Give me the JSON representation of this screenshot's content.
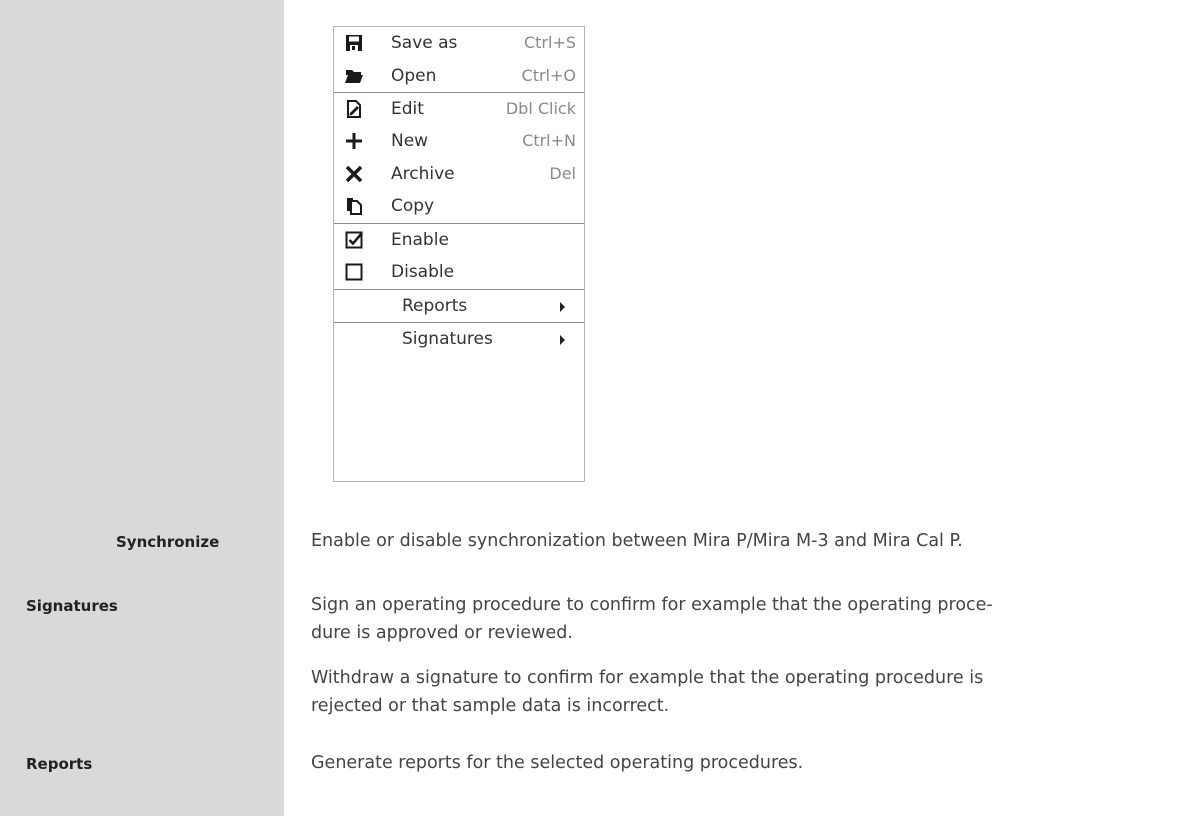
{
  "menu": {
    "items": [
      {
        "label": "Save as",
        "shortcut": "Ctrl+S",
        "icon": "save-icon"
      },
      {
        "label": "Open",
        "shortcut": "Ctrl+O",
        "icon": "folder-open-icon"
      },
      {
        "label": "Edit",
        "shortcut": "Dbl Click",
        "icon": "edit-icon"
      },
      {
        "label": "New",
        "shortcut": "Ctrl+N",
        "icon": "plus-icon"
      },
      {
        "label": "Archive",
        "shortcut": "Del",
        "icon": "x-icon"
      },
      {
        "label": "Copy",
        "shortcut": "",
        "icon": "copy-icon"
      },
      {
        "label": "Enable",
        "shortcut": "",
        "icon": "checkbox-checked-icon"
      },
      {
        "label": "Disable",
        "shortcut": "",
        "icon": "checkbox-empty-icon"
      },
      {
        "label": "Reports",
        "shortcut": "",
        "icon": "submenu-arrow-icon"
      },
      {
        "label": "Signatures",
        "shortcut": "",
        "icon": "submenu-arrow-icon"
      }
    ]
  },
  "definitions": [
    {
      "term": "Synchronize",
      "text": "Enable or disable synchronization between Mira P/Mira M-3 and Mira Cal P."
    },
    {
      "term": "Signatures",
      "text": "Sign an operating procedure to confirm for example that the operating proce-dure is approved or reviewed.",
      "line1": "Sign an operating procedure to confirm for example that the operating proce-",
      "line2": "dure is approved or reviewed.",
      "extra_line1": "Withdraw a signature to confirm for example that the operating procedure is",
      "extra_line2": "rejected or that sample data is incorrect."
    },
    {
      "term": "Reports",
      "text": "Generate reports for the selected operating procedures."
    }
  ]
}
